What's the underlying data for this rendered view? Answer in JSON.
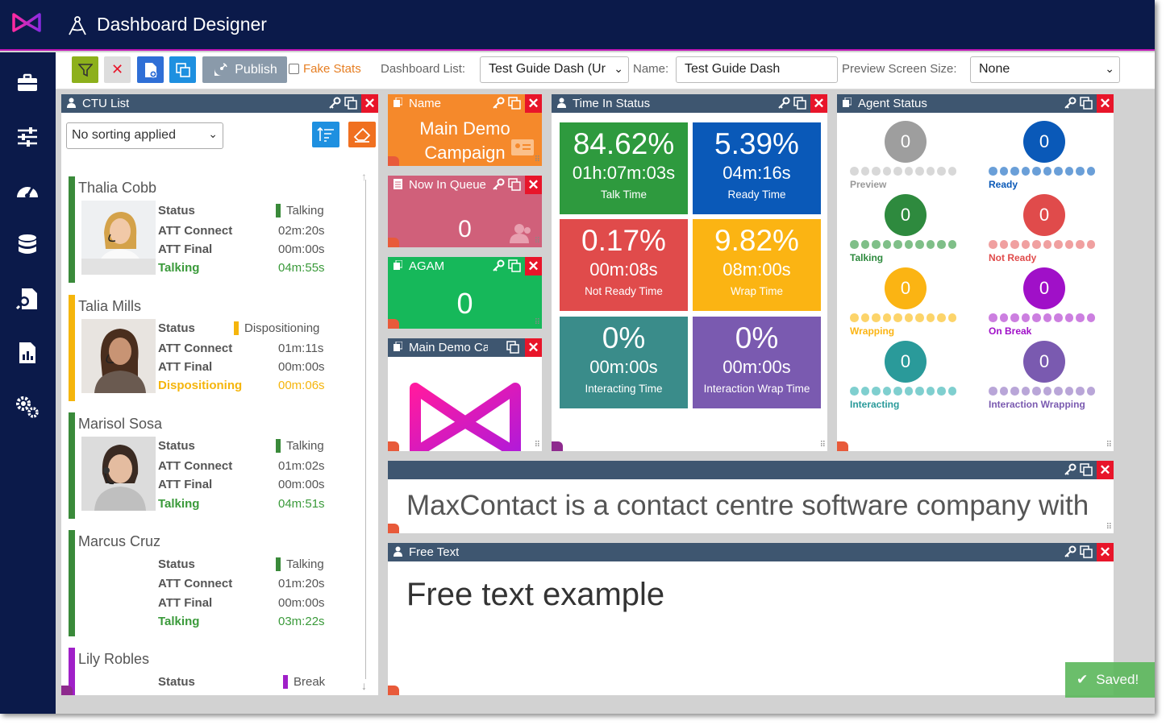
{
  "app": {
    "title": "Dashboard Designer"
  },
  "sidebar": {
    "items": [
      "briefcase-icon",
      "sliders-icon",
      "gauge-icon",
      "database-icon",
      "file-search-icon",
      "report-icon",
      "cogs-icon"
    ]
  },
  "toolbar": {
    "publish_label": "Publish",
    "fake_stats_label": "Fake Stats",
    "dashboard_list_label": "Dashboard List:",
    "dashboard_list_value": "Test Guide Dash (Ur",
    "name_label": "Name:",
    "name_value": "Test Guide Dash",
    "preview_label": "Preview Screen Size:",
    "preview_value": "None"
  },
  "ctu_list": {
    "title": "CTU List",
    "sort_value": "No sorting applied",
    "row_labels": {
      "status": "Status",
      "att_connect": "ATT Connect",
      "att_final": "ATT Final"
    },
    "agents": [
      {
        "name": "Thalia Cobb",
        "status": "Talking",
        "att_connect": "02m:20s",
        "att_final": "00m:00s",
        "state": "Talking",
        "state_time": "04m:55s",
        "color": "#3a8a3a",
        "state_color": "#3a9a3a"
      },
      {
        "name": "Talia Mills",
        "status": "Dispositioning",
        "att_connect": "01m:11s",
        "att_final": "00m:00s",
        "state": "Dispositioning",
        "state_time": "00m:06s",
        "color": "#f5b50c",
        "state_color": "#f5b50c"
      },
      {
        "name": "Marisol Sosa",
        "status": "Talking",
        "att_connect": "01m:02s",
        "att_final": "00m:00s",
        "state": "Talking",
        "state_time": "04m:51s",
        "color": "#3a8a3a",
        "state_color": "#3a9a3a"
      },
      {
        "name": "Marcus Cruz",
        "status": "Talking",
        "att_connect": "01m:20s",
        "att_final": "00m:00s",
        "state": "Talking",
        "state_time": "03m:22s",
        "color": "#3a8a3a",
        "state_color": "#3a9a3a"
      },
      {
        "name": "Lily Robles",
        "status": "Break",
        "color": "#a020c8",
        "state_color": "#a020c8"
      }
    ]
  },
  "name_widget": {
    "title": "Name",
    "value_line1": "Main Demo",
    "value_line2": "Campaign",
    "color": "#f5892b"
  },
  "now_in_queue": {
    "title": "Now In Queue",
    "value": "0",
    "color": "#d0607a"
  },
  "agam": {
    "title": "AGAM",
    "value": "0",
    "color": "#16b85a"
  },
  "main_demo_logo": {
    "title": "Main Demo Campaign"
  },
  "time_in_status": {
    "title": "Time In Status",
    "tiles": [
      {
        "pct": "84.62%",
        "time": "01h:07m:03s",
        "label": "Talk Time",
        "color": "#2e9a3e"
      },
      {
        "pct": "5.39%",
        "time": "04m:16s",
        "label": "Ready Time",
        "color": "#0a59b8"
      },
      {
        "pct": "0.17%",
        "time": "00m:08s",
        "label": "Not Ready Time",
        "color": "#e04b4b"
      },
      {
        "pct": "9.82%",
        "time": "08m:00s",
        "label": "Wrap Time",
        "color": "#fbb413"
      },
      {
        "pct": "0%",
        "time": "00m:00s",
        "label": "Interacting Time",
        "color": "#3a8c8a"
      },
      {
        "pct": "0%",
        "time": "00m:00s",
        "label": "Interaction Wrap Time",
        "color": "#7a5ab0"
      }
    ]
  },
  "agent_status": {
    "title": "Agent Status",
    "cells": [
      {
        "value": "0",
        "label": "Preview",
        "color": "#9e9e9e",
        "dot_color": "#d8d8d8",
        "label_color": "#999999"
      },
      {
        "value": "0",
        "label": "Ready",
        "color": "#0a59b8",
        "dot_color": "#6a9fd8",
        "label_color": "#0a59b8"
      },
      {
        "value": "0",
        "label": "Talking",
        "color": "#2e8a3e",
        "dot_color": "#7fbf88",
        "label_color": "#2e8a3e"
      },
      {
        "value": "0",
        "label": "Not Ready",
        "color": "#e04b4b",
        "dot_color": "#f0a0a0",
        "label_color": "#e04b4b"
      },
      {
        "value": "0",
        "label": "Wrapping",
        "color": "#fbb413",
        "dot_color": "#fcd46a",
        "label_color": "#fbb413"
      },
      {
        "value": "0",
        "label": "On Break",
        "color": "#a010c8",
        "dot_color": "#cc7fe0",
        "label_color": "#a010c8"
      },
      {
        "value": "0",
        "label": "Interacting",
        "color": "#2a9a9a",
        "dot_color": "#7fcfcf",
        "label_color": "#2a9a9a"
      },
      {
        "value": "0",
        "label": "Interaction Wrapping",
        "color": "#7a5ab0",
        "dot_color": "#b9a6d8",
        "label_color": "#7a5ab0"
      }
    ]
  },
  "ticker": {
    "text": "MaxContact is a contact centre software company with"
  },
  "free_text": {
    "title": "Free Text",
    "body": "Free text example"
  },
  "toast": {
    "text": "Saved!"
  },
  "colors": {
    "nav_bg": "#0b1a4a",
    "panel_header": "#3e5670",
    "accent_magenta": "#c017b5"
  }
}
